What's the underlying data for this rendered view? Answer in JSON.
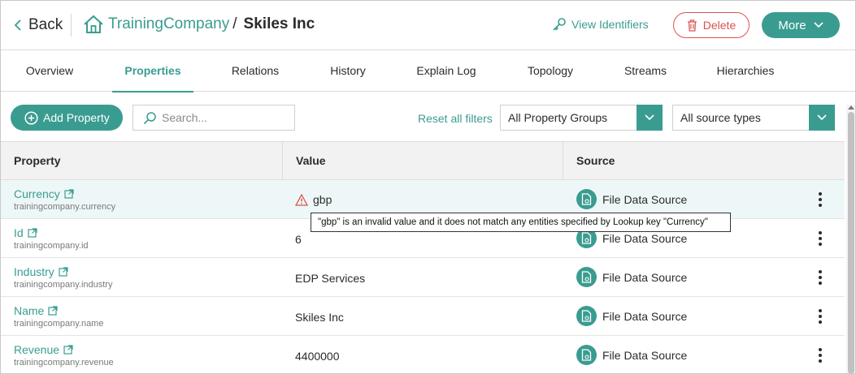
{
  "header": {
    "back_label": "Back",
    "entity_type": "TrainingCompany",
    "separator": "/",
    "entity_name": "Skiles Inc",
    "view_identifiers_label": "View Identifiers",
    "delete_label": "Delete",
    "more_label": "More"
  },
  "tabs": [
    {
      "label": "Overview",
      "active": false
    },
    {
      "label": "Properties",
      "active": true
    },
    {
      "label": "Relations",
      "active": false
    },
    {
      "label": "History",
      "active": false
    },
    {
      "label": "Explain Log",
      "active": false
    },
    {
      "label": "Topology",
      "active": false
    },
    {
      "label": "Streams",
      "active": false
    },
    {
      "label": "Hierarchies",
      "active": false
    }
  ],
  "toolbar": {
    "add_property_label": "Add Property",
    "search_placeholder": "Search...",
    "reset_filters_label": "Reset all filters",
    "property_groups_value": "All Property Groups",
    "source_types_value": "All source types"
  },
  "table": {
    "columns": [
      "Property",
      "Value",
      "Source"
    ],
    "rows": [
      {
        "name": "Currency",
        "key": "trainingcompany.currency",
        "value": "gbp",
        "warning": true,
        "source": "File Data Source"
      },
      {
        "name": "Id",
        "key": "trainingcompany.id",
        "value": "6",
        "warning": false,
        "source": "File Data Source"
      },
      {
        "name": "Industry",
        "key": "trainingcompany.industry",
        "value": "EDP Services",
        "warning": false,
        "source": "File Data Source"
      },
      {
        "name": "Name",
        "key": "trainingcompany.name",
        "value": "Skiles Inc",
        "warning": false,
        "source": "File Data Source"
      },
      {
        "name": "Revenue",
        "key": "trainingcompany.revenue",
        "value": "4400000",
        "warning": false,
        "source": "File Data Source"
      }
    ]
  },
  "tooltip": {
    "text": "\"gbp\" is an invalid value and it does not match any entities specified by Lookup key \"Currency\""
  },
  "icons": {
    "back": "chevron-left-icon",
    "home": "house-icon",
    "key": "key-icon",
    "trash": "trash-icon",
    "more_chevron": "chevron-down-icon",
    "add": "plus-circle-icon",
    "search": "search-icon",
    "external": "external-link-icon",
    "warning": "warning-triangle-icon",
    "source": "file-source-icon",
    "row_menu": "kebab-menu-icon"
  },
  "colors": {
    "accent": "#3a9c91",
    "danger": "#d9534f",
    "row_highlight": "#eef7f7",
    "header_bg": "#f2f2f2"
  }
}
